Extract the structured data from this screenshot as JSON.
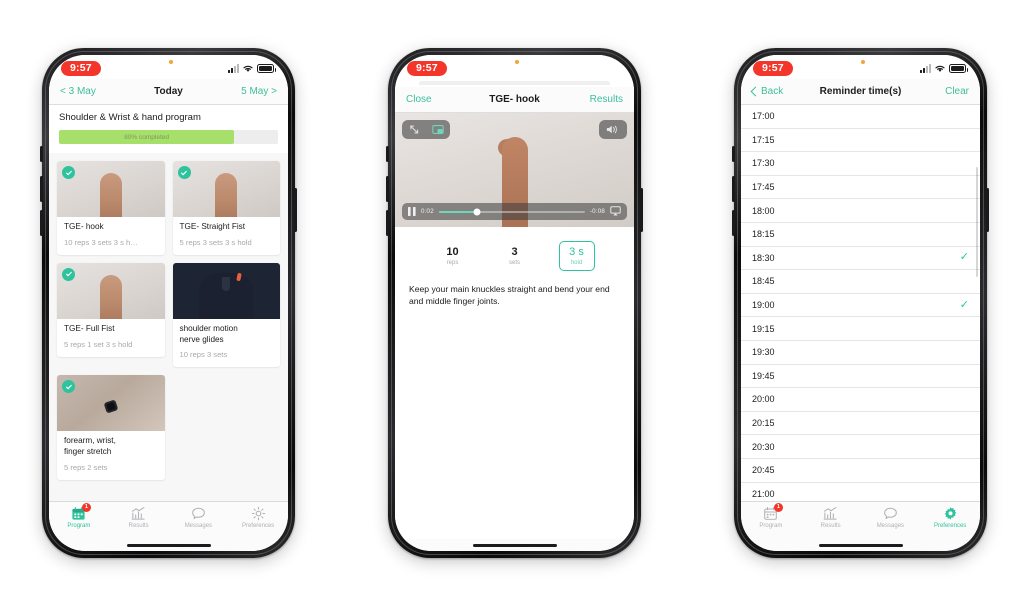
{
  "common": {
    "status": {
      "time": "9:57",
      "icons": [
        "signal-bars",
        "wifi",
        "battery"
      ]
    },
    "tabbar": {
      "items": [
        {
          "label": "Program",
          "icon": "calendar-icon",
          "badge": "1"
        },
        {
          "label": "Results",
          "icon": "chart-icon",
          "badge": ""
        },
        {
          "label": "Messages",
          "icon": "message-icon",
          "badge": ""
        },
        {
          "label": "Preferences",
          "icon": "gear-icon",
          "badge": ""
        }
      ]
    },
    "colors": {
      "accent": "#2ec39c",
      "nav_link": "#3fbf9a",
      "progress": "#a6e06a",
      "badge": "#f4362a",
      "time_pill": "#f4362a"
    }
  },
  "phone1": {
    "nav": {
      "left": "< 3 May",
      "title": "Today",
      "right": "5 May >"
    },
    "program": {
      "title": "Shoulder & Wrist & hand program",
      "progress_label": "80% completed",
      "progress_percent": 80
    },
    "exercises": [
      {
        "name": "TGE- hook",
        "meta": "10 reps 3 sets 3 s h…",
        "done": true,
        "thumb": "hand"
      },
      {
        "name": "TGE- Straight Fist",
        "meta": "5 reps 3 sets 3 s hold",
        "done": true,
        "thumb": "hand"
      },
      {
        "name": "TGE- Full Fist",
        "meta": "5 reps 1 set 3 s hold",
        "done": true,
        "thumb": "hand"
      },
      {
        "name": "shoulder motion\nnerve glides",
        "meta": "10 reps 3 sets",
        "done": false,
        "thumb": "navy"
      },
      {
        "name": "forearm, wrist,\nfinger stretch",
        "meta": "5 reps 2 sets",
        "done": true,
        "thumb": "arm"
      }
    ],
    "active_tab": "Program"
  },
  "phone2": {
    "nav": {
      "left": "Close",
      "title": "TGE- hook",
      "right": "Results"
    },
    "video": {
      "top_left_icons": [
        "fullscreen-icon",
        "picture-in-picture-icon"
      ],
      "top_right_icon": "speaker-icon",
      "play_state_icon": "pause-icon",
      "elapsed": "0:02",
      "remaining": "-0:08",
      "progress_percent": 26,
      "airplay_icon": "airplay-icon"
    },
    "stats": [
      {
        "value": "10",
        "caption": "reps",
        "highlight": false
      },
      {
        "value": "3",
        "caption": "sets",
        "highlight": false
      },
      {
        "value": "3 s",
        "caption": "hold",
        "highlight": true
      }
    ],
    "description": "Keep your main knuckles straight and bend your end and middle finger joints."
  },
  "phone3": {
    "nav": {
      "left": "Back",
      "title": "Reminder time(s)",
      "right": "Clear"
    },
    "times": [
      {
        "time": "17:00",
        "selected": false
      },
      {
        "time": "17:15",
        "selected": false
      },
      {
        "time": "17:30",
        "selected": false
      },
      {
        "time": "17:45",
        "selected": false
      },
      {
        "time": "18:00",
        "selected": false
      },
      {
        "time": "18:15",
        "selected": false
      },
      {
        "time": "18:30",
        "selected": true
      },
      {
        "time": "18:45",
        "selected": false
      },
      {
        "time": "19:00",
        "selected": true
      },
      {
        "time": "19:15",
        "selected": false
      },
      {
        "time": "19:30",
        "selected": false
      },
      {
        "time": "19:45",
        "selected": false
      },
      {
        "time": "20:00",
        "selected": false
      },
      {
        "time": "20:15",
        "selected": false
      },
      {
        "time": "20:30",
        "selected": false
      },
      {
        "time": "20:45",
        "selected": false
      },
      {
        "time": "21:00",
        "selected": false
      }
    ],
    "check_glyph": "✓",
    "active_tab": "Preferences"
  }
}
